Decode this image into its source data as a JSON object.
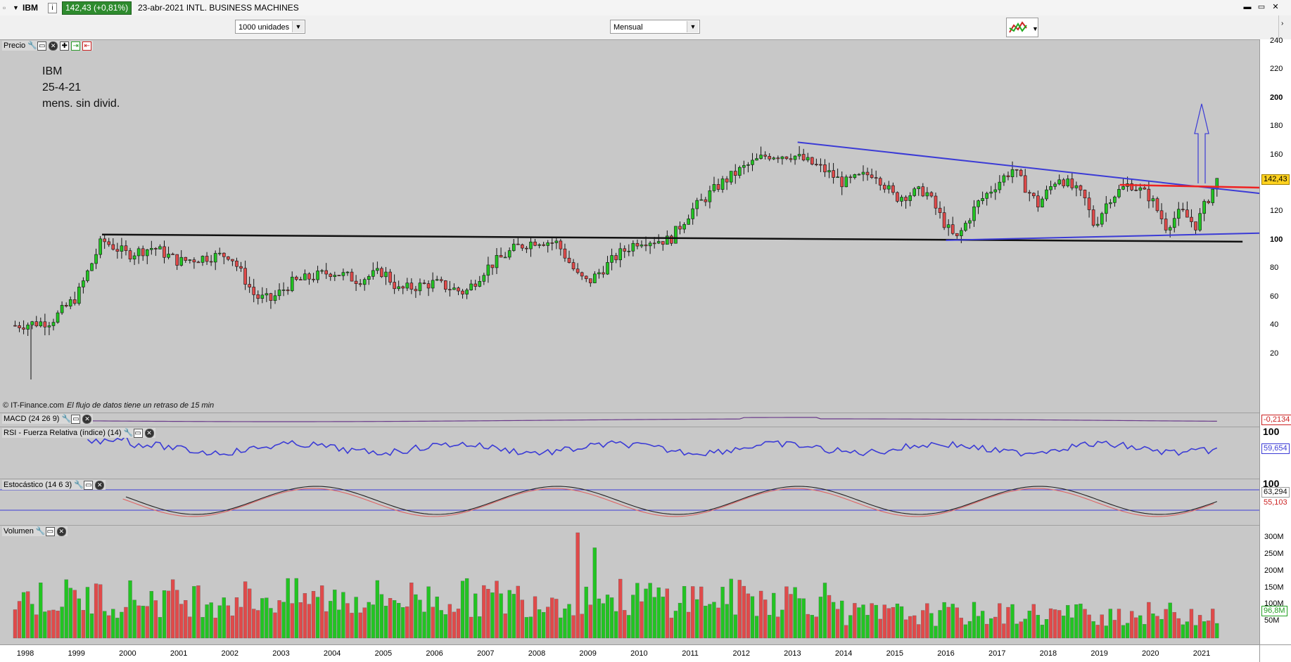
{
  "topbar": {
    "symbol": "IBM",
    "info_icon": "i",
    "price_change": "142,43 (+0,81%)",
    "date_name": "23-abr-2021 INTL. BUSINESS MACHINES",
    "win_buttons": [
      "▬",
      "▭",
      "✕"
    ]
  },
  "toolbar": {
    "units_select": "1000 unidades",
    "period_select": "Mensual"
  },
  "price_pane": {
    "title": "Precio",
    "annotation": [
      "IBM",
      "25-4-21",
      "mens. sin divid."
    ],
    "credit": "© IT-Finance.com",
    "credit_note": "El flujo de datos tiene un retraso de 15 min",
    "axis_ticks": [
      "240",
      "220",
      "200",
      "180",
      "160",
      "140",
      "120",
      "100",
      "80",
      "60",
      "40",
      "20"
    ],
    "last_price_tag": "142,43"
  },
  "macd_pane": {
    "title": "MACD (24 26 9)",
    "tag": "-0,2134"
  },
  "rsi_pane": {
    "title": "RSI - Fuerza Relativa (índice) (14)",
    "axis_top": "100",
    "tag": "59,654"
  },
  "stoch_pane": {
    "title": "Estocástico (14 6 3)",
    "axis_top": "100",
    "tag1": "63,294",
    "tag2": "55,103"
  },
  "volume_pane": {
    "title": "Volumen",
    "axis_ticks": [
      "300M",
      "250M",
      "200M",
      "150M",
      "100M",
      "50M"
    ],
    "tag": "96,8M"
  },
  "x_axis_years": [
    "1998",
    "1999",
    "2000",
    "2001",
    "2002",
    "2003",
    "2004",
    "2005",
    "2006",
    "2007",
    "2008",
    "2009",
    "2010",
    "2011",
    "2012",
    "2013",
    "2014",
    "2015",
    "2016",
    "2017",
    "2018",
    "2019",
    "2020",
    "2021"
  ],
  "colors": {
    "up": "#22c422",
    "down": "#e04a4a",
    "blue_line": "#3b3bd6",
    "red_line": "#ee2222",
    "pane_bg": "#c8c8c8"
  }
}
